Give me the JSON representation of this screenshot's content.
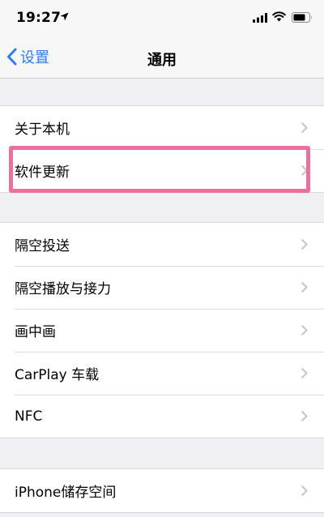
{
  "status": {
    "time": "19:27"
  },
  "nav": {
    "back_label": "设置",
    "title": "通用"
  },
  "groups": [
    {
      "items": [
        {
          "label": "关于本机"
        },
        {
          "label": "软件更新"
        }
      ]
    },
    {
      "items": [
        {
          "label": "隔空投送"
        },
        {
          "label": "隔空播放与接力"
        },
        {
          "label": "画中画"
        },
        {
          "label": "CarPlay 车载"
        },
        {
          "label": "NFC"
        }
      ]
    },
    {
      "items": [
        {
          "label": "iPhone储存空间"
        }
      ]
    }
  ],
  "highlight": {
    "target": "软件更新",
    "color": "#ee6f9d"
  },
  "colors": {
    "accent": "#2f7cf6",
    "background": "#efeff4"
  }
}
